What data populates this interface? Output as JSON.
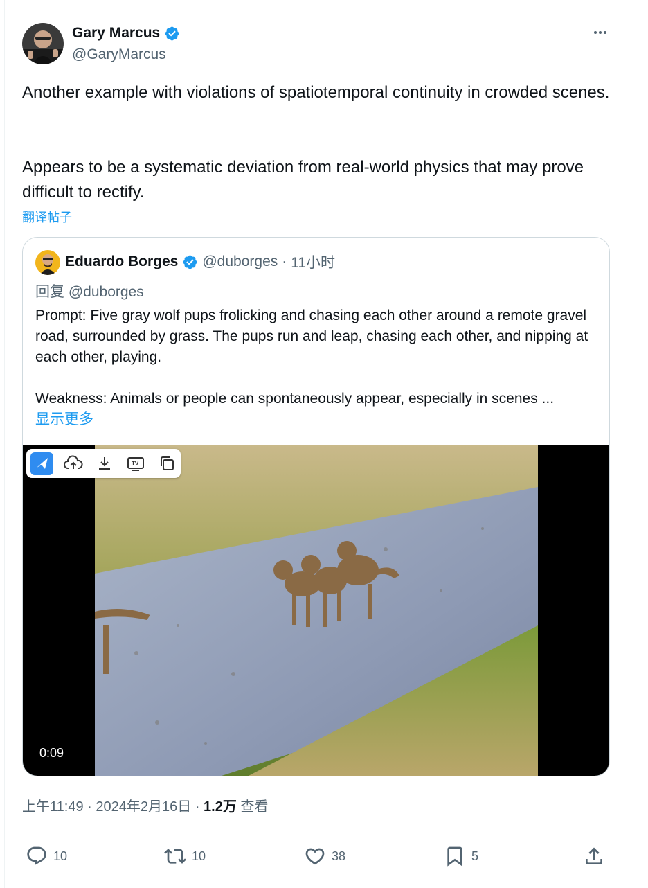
{
  "post": {
    "author_name": "Gary Marcus",
    "author_handle": "@GaryMarcus",
    "paragraph1": "Another example with violations of spatiotemporal continuity in crowded scenes.",
    "paragraph2": "Appears to be a systematic deviation from real-world physics that may prove difficult to rectify.",
    "translate_label": "翻译帖子",
    "more_icon": "more-horizontal-icon",
    "verified_color": "#1d9bf0"
  },
  "quote": {
    "author_name": "Eduardo Borges",
    "author_handle": "@duborges",
    "separator": "·",
    "time_ago": "11小时",
    "reply_prefix": "回复",
    "reply_handle": "@duborges",
    "paragraph1": "Prompt: Five gray wolf pups frolicking and chasing each other around a remote gravel road, surrounded by grass. The pups run and leap, chasing each other, and nipping at each other, playing.",
    "paragraph2": "Weakness: Animals or people can spontaneously appear, especially in scenes ...",
    "show_more_label": "显示更多",
    "video_duration": "0:09",
    "video_toolbar": [
      "app-logo-icon",
      "cloud-upload-icon",
      "download-icon",
      "tv-icon",
      "copy-icon"
    ]
  },
  "meta": {
    "time": "上午11:49",
    "separator": "·",
    "date": "2024年2月16日",
    "views_count": "1.2万",
    "views_label": "查看"
  },
  "actions": {
    "replies": "10",
    "reposts": "10",
    "likes": "38",
    "bookmarks": "5",
    "icons": [
      "reply-icon",
      "repost-icon",
      "like-icon",
      "bookmark-icon",
      "share-icon"
    ]
  },
  "colors": {
    "accent": "#1d9bf0",
    "text_primary": "#0f1419",
    "text_secondary": "#536471",
    "border": "#cfd9de"
  }
}
